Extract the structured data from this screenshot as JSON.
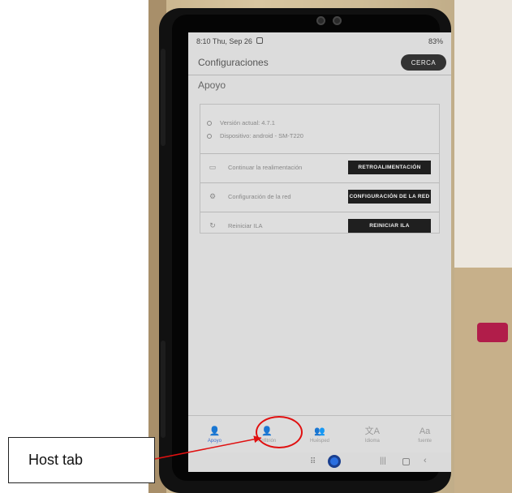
{
  "status_bar": {
    "time": "8:10  Thu, Sep 26",
    "battery": "83%"
  },
  "app_bar": {
    "title": "Configuraciones",
    "close_label": "CERCA"
  },
  "section": {
    "title": "Apoyo"
  },
  "info": [
    {
      "text": "Versión actual: 4.7.1",
      "icon": "info-icon"
    },
    {
      "text": "Dispositivo: android - SM-T220",
      "icon": "tablet-icon"
    }
  ],
  "actions": [
    {
      "label": "Continuar la realimentación",
      "button": "RETROALIMENTACIÓN",
      "icon": "chat-icon"
    },
    {
      "label": "Configuración de la red",
      "button": "CONFIGURACIÓN DE LA RED",
      "icon": "gear-icon"
    },
    {
      "label": "Reiniciar ILA",
      "button": "REINICIAR ILA",
      "icon": "refresh-icon"
    }
  ],
  "nav": [
    {
      "label": "Apoyo",
      "icon": "person-icon",
      "glyph": "👤",
      "active": true
    },
    {
      "label": "Anfitrión",
      "icon": "person-icon",
      "glyph": "👤",
      "active": false
    },
    {
      "label": "Huésped",
      "icon": "people-icon",
      "glyph": "👥",
      "active": false
    },
    {
      "label": "Idioma",
      "icon": "translate-icon",
      "glyph": "文A",
      "active": false
    },
    {
      "label": "fuente",
      "icon": "font-icon",
      "glyph": "Aa",
      "active": false
    }
  ],
  "annotation": {
    "label": "Host tab",
    "color": "#e01010"
  },
  "colors": {
    "accent": "#3b6fd1",
    "button": "#1f1f1f",
    "annotation": "#e01010"
  }
}
